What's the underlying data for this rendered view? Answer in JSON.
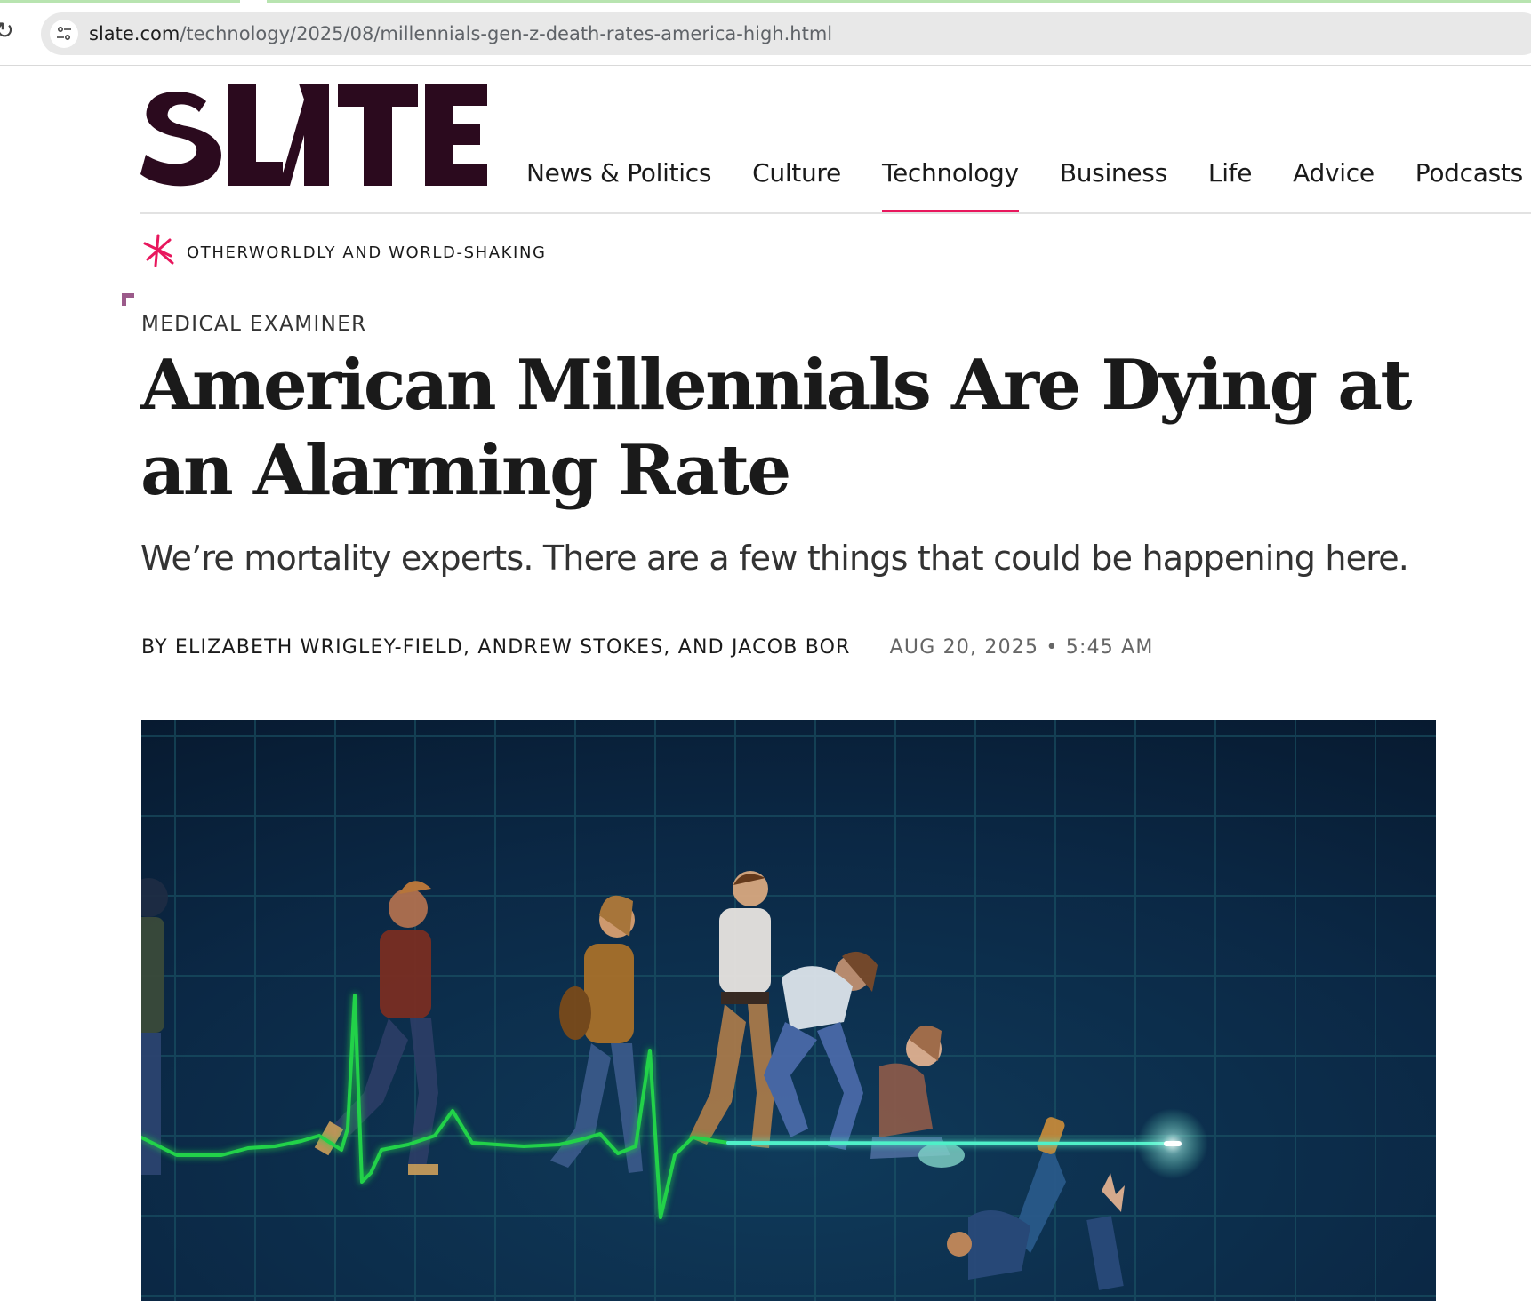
{
  "browser": {
    "url_domain": "slate.com",
    "url_path": "/technology/2025/08/millennials-gen-z-death-rates-america-high.html"
  },
  "site": {
    "logo_text": "SLATE",
    "nav": [
      {
        "label": "News & Politics",
        "active": false
      },
      {
        "label": "Culture",
        "active": false
      },
      {
        "label": "Technology",
        "active": true
      },
      {
        "label": "Business",
        "active": false
      },
      {
        "label": "Life",
        "active": false
      },
      {
        "label": "Advice",
        "active": false
      },
      {
        "label": "Podcasts",
        "active": false
      }
    ],
    "accent_color": "#e8175d",
    "logo_color": "#2b0a1e"
  },
  "series": {
    "label": "OTHERWORLDLY AND WORLD-SHAKING",
    "icon": "asterisk-star-icon"
  },
  "article": {
    "kicker": "MEDICAL EXAMINER",
    "headline_line1": "American Millennials Are Dying at",
    "headline_line2": "an Alarming Rate",
    "dek": "We’re mortality experts. There are a few things that could be happening here.",
    "byline": "BY ELIZABETH WRIGLEY-FIELD, ANDREW STOKES, AND JACOB BOR",
    "date": "AUG 20, 2025",
    "time": "5:45 AM"
  }
}
